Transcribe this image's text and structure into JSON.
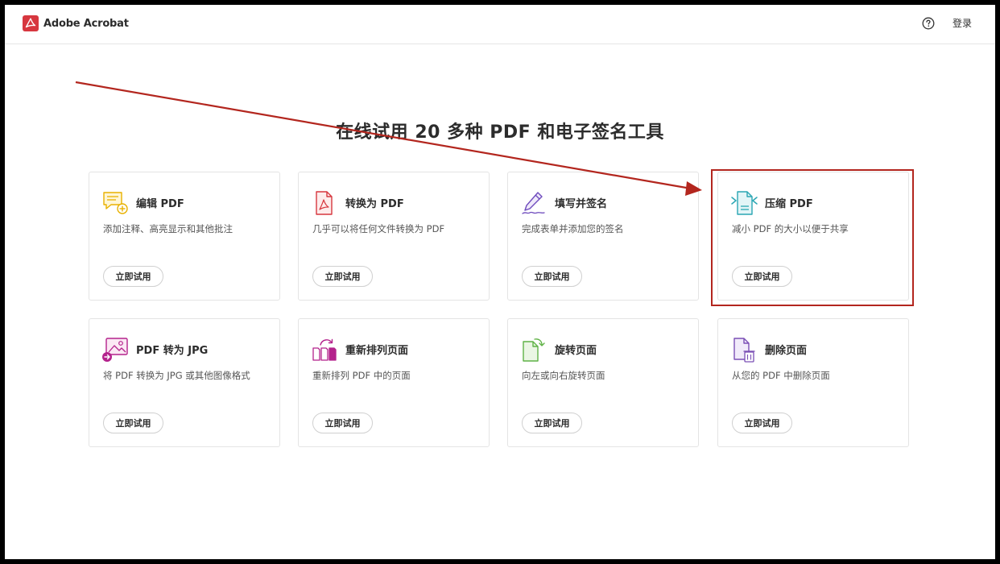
{
  "header": {
    "brand_name": "Adobe Acrobat",
    "login_label": "登录"
  },
  "main": {
    "title": "在线试用 20 多种 PDF 和电子签名工具"
  },
  "tools": [
    {
      "title": "编辑 PDF",
      "desc": "添加注释、高亮显示和其他批注",
      "button": "立即试用",
      "icon": "edit-comment-icon"
    },
    {
      "title": "转换为 PDF",
      "desc": "几乎可以将任何文件转换为 PDF",
      "button": "立即试用",
      "icon": "convert-pdf-icon"
    },
    {
      "title": "填写并签名",
      "desc": "完成表单并添加您的签名",
      "button": "立即试用",
      "icon": "sign-pen-icon"
    },
    {
      "title": "压缩 PDF",
      "desc": "减小 PDF 的大小以便于共享",
      "button": "立即试用",
      "icon": "compress-pdf-icon"
    },
    {
      "title": "PDF 转为 JPG",
      "desc": "将 PDF 转换为 JPG 或其他图像格式",
      "button": "立即试用",
      "icon": "pdf-to-jpg-icon"
    },
    {
      "title": "重新排列页面",
      "desc": "重新排列 PDF 中的页面",
      "button": "立即试用",
      "icon": "reorder-pages-icon"
    },
    {
      "title": "旋转页面",
      "desc": "向左或向右旋转页面",
      "button": "立即试用",
      "icon": "rotate-page-icon"
    },
    {
      "title": "删除页面",
      "desc": "从您的 PDF 中删除页面",
      "button": "立即试用",
      "icon": "delete-page-icon"
    }
  ],
  "colors": {
    "brand_red": "#d7373f",
    "annotation_red": "#b3261e",
    "edit_yellow": "#e8b100",
    "convert_red": "#d7373f",
    "sign_purple": "#6e4bbd",
    "compress_teal": "#2aa6b3",
    "jpg_purple": "#b4228c",
    "green": "#5fb246",
    "delete_purple": "#7a4fb5"
  }
}
